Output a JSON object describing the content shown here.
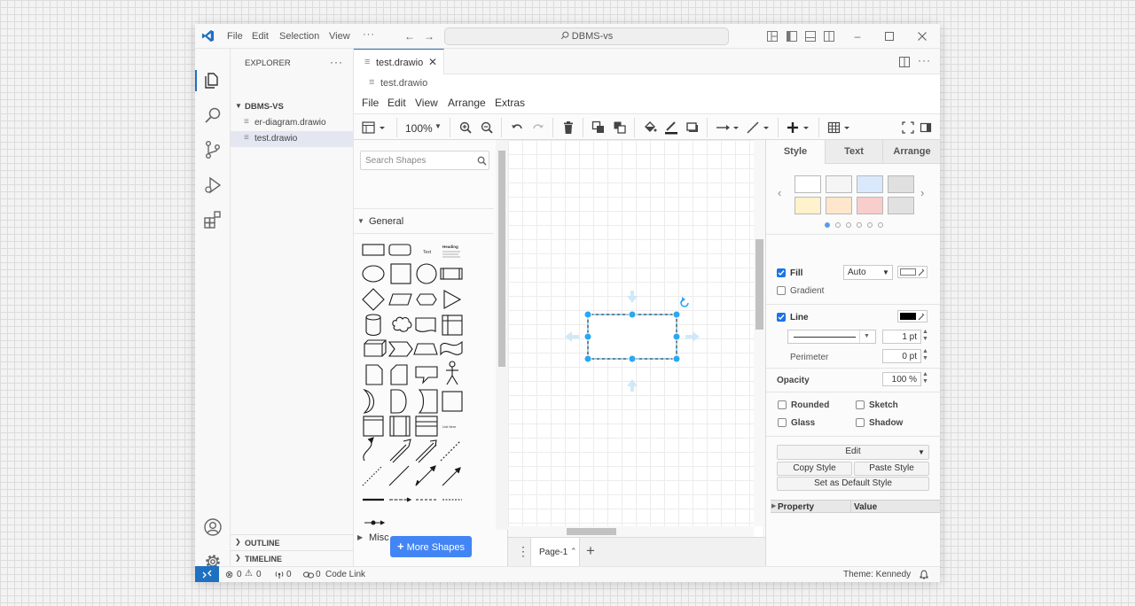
{
  "titlebar": {
    "menus": [
      "File",
      "Edit",
      "Selection",
      "View"
    ],
    "more": "···",
    "command_center": "DBMS-vs",
    "command_icon": "search-icon"
  },
  "sidebar": {
    "title": "EXPLORER",
    "more": "···",
    "folder": "DBMS-VS",
    "files": [
      "er-diagram.drawio",
      "test.drawio"
    ],
    "sections": [
      "OUTLINE",
      "TIMELINE"
    ]
  },
  "editor": {
    "tab": "test.drawio",
    "breadcrumb": "test.drawio",
    "more": "···"
  },
  "drawio": {
    "menus": [
      "File",
      "Edit",
      "View",
      "Arrange",
      "Extras"
    ],
    "zoom": "100%",
    "search_placeholder": "Search Shapes",
    "general": "General",
    "misc": "Misc",
    "more_shapes": "More Shapes",
    "shape_texts": {
      "text": "Text",
      "heading": "Heading",
      "list": "List Item"
    },
    "page": "Page-1"
  },
  "format": {
    "tabs": [
      "Style",
      "Text",
      "Arrange"
    ],
    "swatches": [
      [
        "#ffffff",
        "#f5f5f5",
        "#dae8fc",
        "#e0e0e0"
      ],
      [
        "#fff2cc",
        "#ffe6cc",
        "#f8cecc",
        "#e1e1e1"
      ]
    ],
    "fill": "Fill",
    "fill_mode": "Auto",
    "gradient": "Gradient",
    "line": "Line",
    "line_width": "1 pt",
    "perimeter": "Perimeter",
    "perimeter_value": "0 pt",
    "opacity": "Opacity",
    "opacity_value": "100 %",
    "rounded": "Rounded",
    "sketch": "Sketch",
    "glass": "Glass",
    "shadow": "Shadow",
    "edit": "Edit",
    "copy_style": "Copy Style",
    "paste_style": "Paste Style",
    "set_default": "Set as Default Style",
    "property": "Property",
    "value": "Value"
  },
  "status": {
    "errors": "0",
    "warnings": "0",
    "ports": "0",
    "code_link_count": "0",
    "code_link": "Code Link",
    "theme": "Theme: Kennedy"
  },
  "colors": {
    "accent": "#1f70c1",
    "selection": "#29a8f4",
    "button_blue": "#4285f4"
  }
}
